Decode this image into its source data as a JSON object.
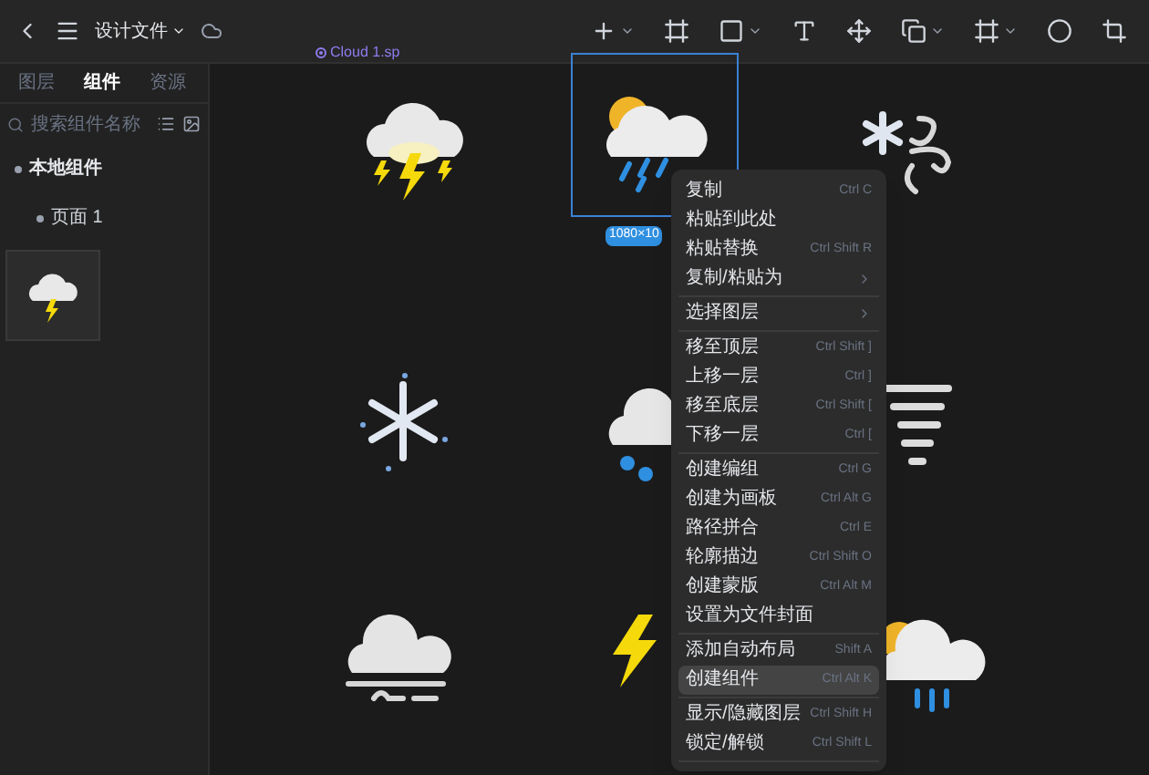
{
  "topbar": {
    "title": "设计文件"
  },
  "sidebar": {
    "tabs": [
      {
        "label": "图层",
        "selected": false
      },
      {
        "label": "组件",
        "selected": true
      },
      {
        "label": "资源",
        "selected": false
      }
    ],
    "search": {
      "placeholder": "搜索组件名称"
    },
    "tree": [
      {
        "label": "本地组件",
        "expanded": true,
        "children": [
          {
            "label": "页面 1",
            "expanded": true
          }
        ]
      }
    ]
  },
  "canvas": {
    "frame_label": "Cloud 1.sp",
    "size_badge": "1080×10"
  },
  "context_menu": [
    {
      "kind": "item",
      "label": "复制",
      "shortcut": "Ctrl C",
      "selected": false
    },
    {
      "kind": "item",
      "label": "粘贴到此处",
      "selected": false
    },
    {
      "kind": "item",
      "label": "粘贴替换",
      "shortcut": "Ctrl Shift R",
      "selected": false
    },
    {
      "kind": "item",
      "label": "复制/粘贴为",
      "submenu": true,
      "selected": false
    },
    {
      "kind": "separator"
    },
    {
      "kind": "item",
      "label": "选择图层",
      "submenu": true,
      "selected": false
    },
    {
      "kind": "separator"
    },
    {
      "kind": "item",
      "label": "移至顶层",
      "shortcut": "Ctrl Shift ]",
      "selected": false
    },
    {
      "kind": "item",
      "label": "上移一层",
      "shortcut": "Ctrl ]",
      "selected": false
    },
    {
      "kind": "item",
      "label": "移至底层",
      "shortcut": "Ctrl Shift [",
      "selected": false
    },
    {
      "kind": "item",
      "label": "下移一层",
      "shortcut": "Ctrl [",
      "selected": false
    },
    {
      "kind": "separator"
    },
    {
      "kind": "item",
      "label": "创建编组",
      "shortcut": "Ctrl G",
      "selected": false
    },
    {
      "kind": "item",
      "label": "创建为画板",
      "shortcut": "Ctrl Alt G",
      "selected": false
    },
    {
      "kind": "item",
      "label": "路径拼合",
      "shortcut": "Ctrl E",
      "selected": false
    },
    {
      "kind": "item",
      "label": "轮廓描边",
      "shortcut": "Ctrl Shift O",
      "selected": false
    },
    {
      "kind": "item",
      "label": "创建蒙版",
      "shortcut": "Ctrl Alt M",
      "selected": false
    },
    {
      "kind": "item",
      "label": "设置为文件封面",
      "selected": false
    },
    {
      "kind": "separator"
    },
    {
      "kind": "item",
      "label": "添加自动布局",
      "shortcut": "Shift A",
      "selected": false
    },
    {
      "kind": "item",
      "label": "创建组件",
      "shortcut": "Ctrl Alt K",
      "selected": true
    },
    {
      "kind": "separator"
    },
    {
      "kind": "item",
      "label": "显示/隐藏图层",
      "shortcut": "Ctrl Shift H",
      "selected": false
    },
    {
      "kind": "item",
      "label": "锁定/解锁",
      "shortcut": "Ctrl Shift L",
      "selected": false
    },
    {
      "kind": "separator"
    }
  ]
}
